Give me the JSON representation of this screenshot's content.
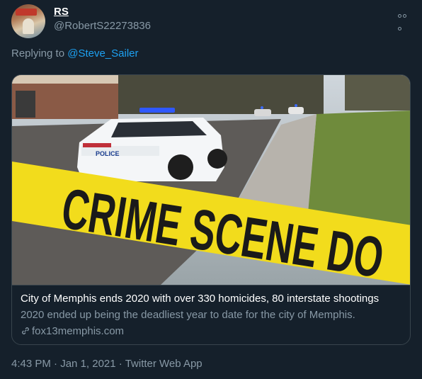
{
  "tweet": {
    "display_name": "RS",
    "handle": "@RobertS22273836",
    "replying_prefix": "Replying to ",
    "replying_to": "@Steve_Sailer",
    "card": {
      "image_text": "CRIME SCENE DO",
      "car_text": "POLICE",
      "title": "City of Memphis ends 2020 with over 330 homicides, 80 interstate shootings",
      "description": "2020 ended up being the deadliest year to date for the city of Memphis.",
      "domain": "fox13memphis.com",
      "link_icon": "link-icon"
    },
    "footer": {
      "time": "4:43 PM",
      "separator": " · ",
      "date": "Jan 1, 2021",
      "separator2": " · ",
      "source": "Twitter Web App"
    }
  },
  "colors": {
    "background": "#15202b",
    "accent": "#1da1f2",
    "muted": "#8899a6",
    "border": "#38444d",
    "tape": "#f2dc1c"
  },
  "icons": [
    "avatar",
    "more-icon",
    "link-icon"
  ]
}
